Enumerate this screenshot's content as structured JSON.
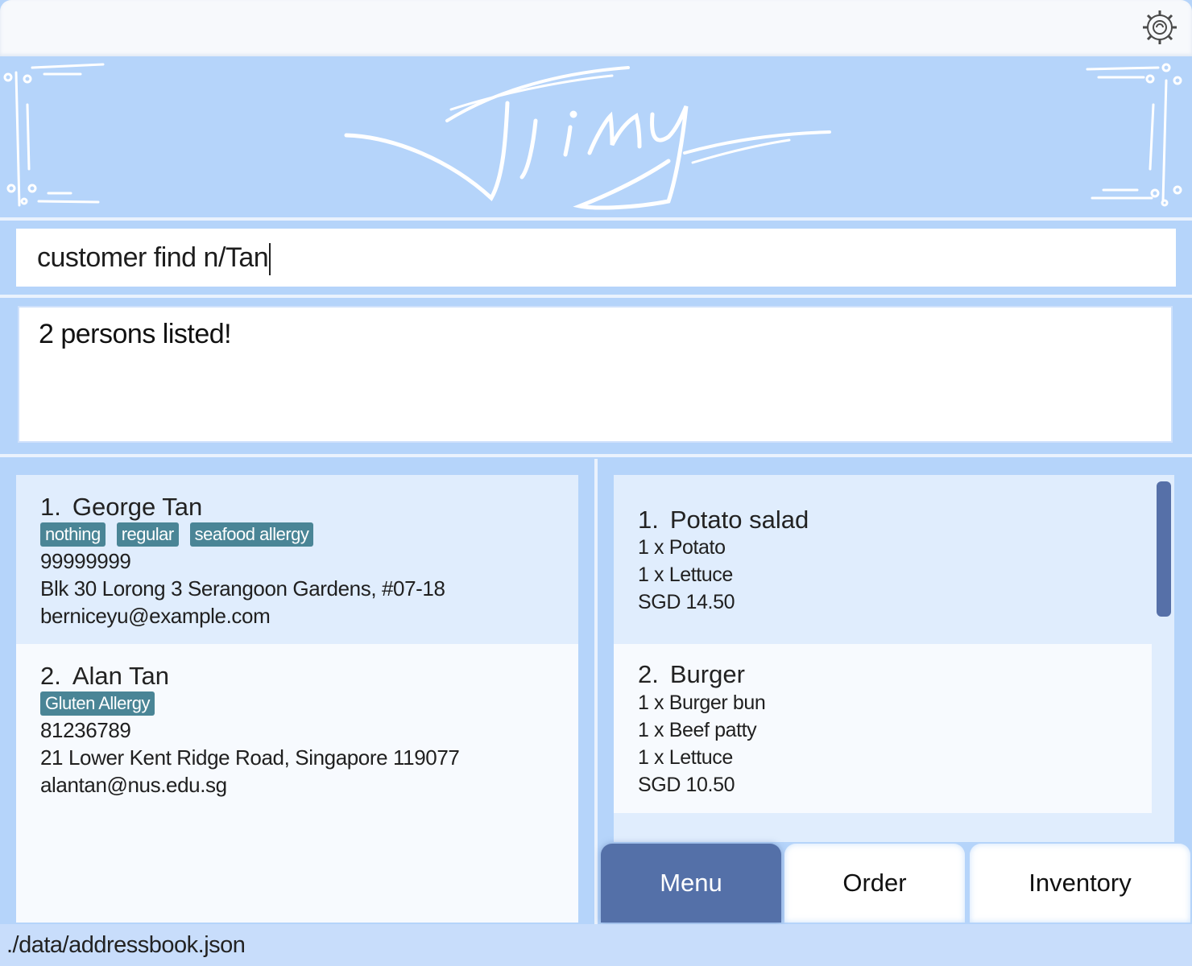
{
  "topbar": {
    "settings_icon": "gear-icon"
  },
  "banner": {
    "logo_text": "Jimy"
  },
  "command": {
    "value": "customer find n/Tan"
  },
  "result": {
    "text": "2 persons listed!"
  },
  "persons": [
    {
      "index": "1.",
      "name": "George Tan",
      "tags": [
        "nothing",
        "regular",
        "seafood allergy"
      ],
      "phone": "99999999",
      "address": "Blk 30 Lorong 3 Serangoon Gardens, #07-18",
      "email": "berniceyu@example.com"
    },
    {
      "index": "2.",
      "name": "Alan Tan",
      "tags": [
        "Gluten Allergy"
      ],
      "phone": "81236789",
      "address": "21 Lower Kent Ridge Road, Singapore 119077",
      "email": "alantan@nus.edu.sg"
    }
  ],
  "menu_items": [
    {
      "index": "1.",
      "name": "Potato salad",
      "ingredients": [
        "1 x Potato",
        "1 x Lettuce"
      ],
      "price": "SGD 14.50"
    },
    {
      "index": "2.",
      "name": "Burger",
      "ingredients": [
        "1 x Burger bun",
        "1 x Beef patty",
        "1 x Lettuce"
      ],
      "price": "SGD 10.50"
    }
  ],
  "tabs": [
    {
      "label": "Menu",
      "active": true
    },
    {
      "label": "Order",
      "active": false
    },
    {
      "label": "Inventory",
      "active": false
    }
  ],
  "status": {
    "path": "./data/addressbook.json"
  },
  "colors": {
    "background": "#b5d4fa",
    "tag": "#4a8596",
    "active_tab": "#5470a8",
    "card_alt": "#e0edfd"
  }
}
